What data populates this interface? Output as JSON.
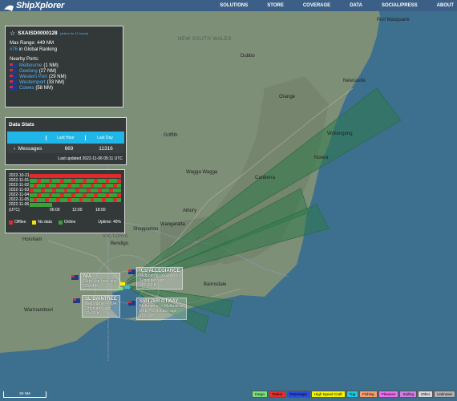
{
  "navbar": {
    "logo_text": "ShipXplorer",
    "items": [
      "SOLUTIONS",
      "STORE",
      "COVERAGE",
      "DATA",
      "SOCIAL/PRESS",
      "ABOUT"
    ]
  },
  "station": {
    "title": "SXAISD0000128",
    "online_note": "(online for 11 hours)",
    "max_range": "Max Range: 449 NM",
    "rank_link": "#76",
    "rank_text": " in Global Ranking",
    "nearby_heading": "Nearby Ports:",
    "ports": [
      {
        "name": "Melbourne",
        "dist": "(1 NM)"
      },
      {
        "name": "Geelong",
        "dist": "(27 NM)"
      },
      {
        "name": "Western Port",
        "dist": "(29 NM)"
      },
      {
        "name": "Westernport",
        "dist": "(33 NM)"
      },
      {
        "name": "Cowes",
        "dist": "(58 NM)"
      }
    ]
  },
  "datastats": {
    "title": "Data Stats",
    "col_last_hour": "Last Hour",
    "col_last_day": "Last Day",
    "row_label": "Messages",
    "last_hour": "669",
    "last_day": "11316",
    "updated": "Last updated 2022-11-06 05:11 UTC"
  },
  "uptime": {
    "dates": [
      "2022-10-31",
      "2022-11-01",
      "2022-11-02",
      "2022-11-03",
      "2022-11-04",
      "2022-11-05",
      "2022-11-06"
    ],
    "axis": [
      "(UTC)",
      "06:00",
      "12:00",
      "18:00"
    ],
    "legend": [
      {
        "label": "Offline",
        "color": "#e02b2b"
      },
      {
        "label": "No data",
        "color": "#f2e600"
      },
      {
        "label": "Online",
        "color": "#3aa13a"
      }
    ],
    "uptime_text": "Uptime: 46%"
  },
  "map_labels": {
    "new_south_wales": "NEW SOUTH WALES",
    "victoria": "VICTORIA",
    "cities": [
      "Dubbo",
      "Newcastle",
      "Port Macquarie",
      "Orange",
      "Griffith",
      "Wagga Wagga",
      "Canberra",
      "Albury",
      "Wangaratta",
      "Shepparton",
      "Bendigo",
      "Horsham",
      "Bairnsdale",
      "Warrnambool",
      "Wollongong",
      "Nowra"
    ]
  },
  "ships": [
    {
      "name": "ICS ALLEGIANCE",
      "route": "Melbourne -> Geelong",
      "time": "7 minutes ago",
      "size": "301x60 ft"
    },
    {
      "name": "N/A",
      "route": "6 kts - an hour ago",
      "time": "",
      "size": "52x14 ft"
    },
    {
      "name": "SL DAINTREE",
      "route": "Melbourne -> N/A",
      "time": "9 minutes ago",
      "size": "79x36 ft"
    },
    {
      "name": "SVITZER OTWAY",
      "route": "Melbourne -> Melbourne",
      "time": "8 kts - 5 minutes ago",
      "size": "79x39 ft"
    }
  ],
  "type_legend": [
    {
      "label": "Cargo",
      "color": "#7be07b"
    },
    {
      "label": "Tanker",
      "color": "#e03030"
    },
    {
      "label": "Passenger",
      "color": "#2a4cd8"
    },
    {
      "label": "High Speed Craft",
      "color": "#f5f500"
    },
    {
      "label": "Tug",
      "color": "#20c8e0"
    },
    {
      "label": "Fishing",
      "color": "#f4a070"
    },
    {
      "label": "Pleasure",
      "color": "#f070f0"
    },
    {
      "label": "Sailing",
      "color": "#d07fe0"
    },
    {
      "label": "Other",
      "color": "#d8d8d8"
    },
    {
      "label": "Unknown",
      "color": "#b0b0b0"
    }
  ],
  "scale_text": "50 NM",
  "colors": {
    "navbar": "#3b5f86",
    "water": "#3d6f8f",
    "land": "#7d8f77",
    "coverage": "#2f7a4a",
    "accent": "#20b7e8"
  }
}
